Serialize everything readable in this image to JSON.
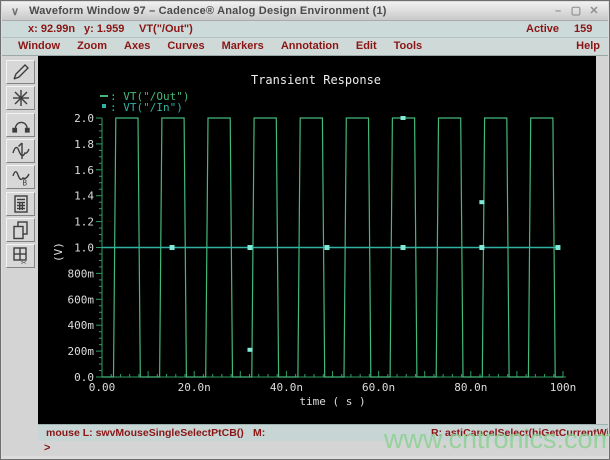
{
  "window": {
    "title": "Waveform Window 97 – Cadence® Analog Design Environment (1)",
    "chevron": "∨",
    "minimize": "–",
    "maximize": "▢",
    "close": "✕"
  },
  "status_bar": {
    "x_readout": "x: 92.99n",
    "y_readout": "y: 1.959",
    "expression": "VT(\"/Out\")",
    "active_label": "Active",
    "active_value": "159"
  },
  "menu": {
    "items": [
      "Window",
      "Zoom",
      "Axes",
      "Curves",
      "Markers",
      "Annotation",
      "Edit",
      "Tools"
    ],
    "help": "Help"
  },
  "toolbar": {
    "buttons": [
      {
        "icon": "pencil-icon"
      },
      {
        "icon": "zoom-fit-icon"
      },
      {
        "icon": "pan-arc-icon"
      },
      {
        "icon": "vertical-marker-icon"
      },
      {
        "icon": "horizontal-marker-icon"
      },
      {
        "icon": "calculator-icon"
      },
      {
        "icon": "copy-window-icon"
      },
      {
        "icon": "slice-icon"
      }
    ]
  },
  "chart_data": {
    "type": "line",
    "title": "Transient Response",
    "xlabel": "time ( s )",
    "ylabel": "(V)",
    "xlim_ns": [
      0,
      100
    ],
    "ylim_v": [
      0,
      2
    ],
    "x_tick_labels": [
      [
        "0.00",
        0
      ],
      [
        "20.0n",
        20
      ],
      [
        "40.0n",
        40
      ],
      [
        "60.0n",
        60
      ],
      [
        "80.0n",
        80
      ],
      [
        "100n",
        100
      ]
    ],
    "y_tick_labels": [
      [
        "0.0",
        0
      ],
      [
        "200m",
        0.2
      ],
      [
        "400m",
        0.4
      ],
      [
        "600m",
        0.6
      ],
      [
        "800m",
        0.8
      ],
      [
        "1.0",
        1.0
      ],
      [
        "1.2",
        1.2
      ],
      [
        "1.4",
        1.4
      ],
      [
        "1.6",
        1.6
      ],
      [
        "1.8",
        1.8
      ],
      [
        "2.0",
        2.0
      ]
    ],
    "axis_color": "#2f9e63",
    "tick_label_color": "#dcdcdc",
    "title_color": "#ededed",
    "series": [
      {
        "name": "VT(\"/Out\")",
        "color": "#44b878",
        "shape": "square-wave",
        "low_v": 0,
        "high_v": 2,
        "period_ns": 10,
        "rise_start_ns": 2.5,
        "fall_start_ns": 7.8,
        "edge_ns": 0.5,
        "cycles": 10
      },
      {
        "name": "VT(\"/In\")",
        "color": "#2fb3a0",
        "shape": "constant",
        "value_v": 1.0,
        "start_ns": 0,
        "end_ns": 99.4,
        "marker_color": "#82e8d8",
        "marker_times_ns": [
          15.2,
          32.1,
          48.8,
          65.3,
          82.4,
          98.9
        ]
      }
    ],
    "stray_markers": [
      {
        "t_ns": 32.1,
        "v": 0.21
      },
      {
        "t_ns": 65.3,
        "v": 2.0
      },
      {
        "t_ns": 82.4,
        "v": 1.35
      }
    ]
  },
  "mouse_bar": {
    "left": "mouse L: swvMouseSingleSelectPtCB()",
    "middle": "M:",
    "right": "R: astiCancelSelect(hiGetCurrentWindow"
  },
  "command_line": {
    "prompt": ">"
  },
  "watermark": "www.cntronics.com"
}
